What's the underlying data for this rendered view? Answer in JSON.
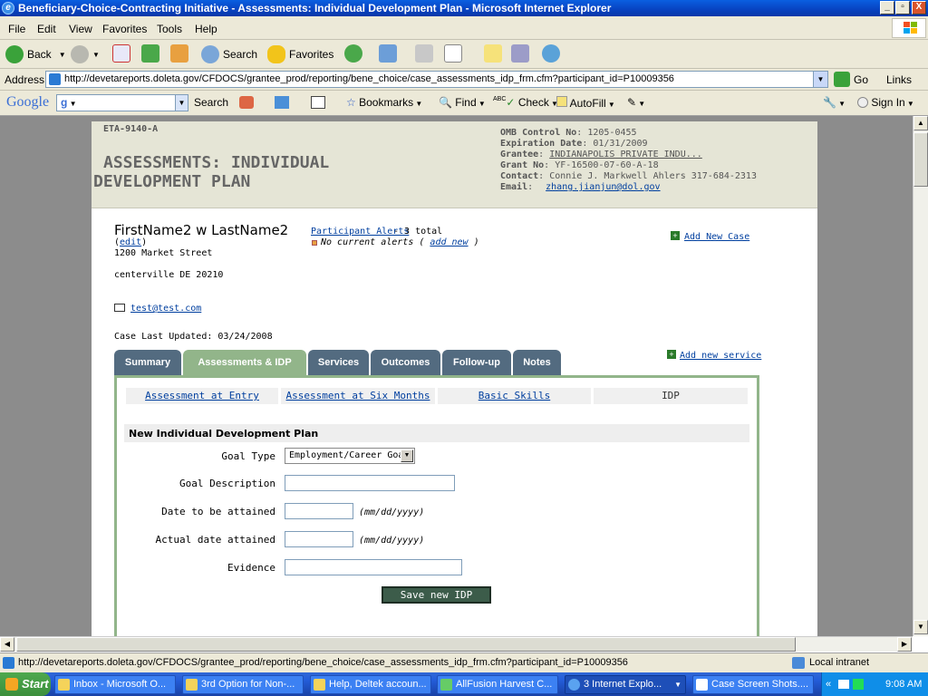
{
  "window": {
    "title": "Beneficiary-Choice-Contracting Initiative - Assessments: Individual Development Plan - Microsoft Internet Explorer",
    "minimize": "_",
    "maximize": "▫",
    "close": "X"
  },
  "menu": [
    "File",
    "Edit",
    "View",
    "Favorites",
    "Tools",
    "Help"
  ],
  "toolbar": {
    "back": "Back",
    "search": "Search",
    "favorites": "Favorites"
  },
  "address": {
    "label": "Address",
    "url": "http://devetareports.doleta.gov/CFDOCS/grantee_prod/reporting/bene_choice/case_assessments_idp_frm.cfm?participant_id=P10009356",
    "go": "Go",
    "links": "Links"
  },
  "google_bar": {
    "logo": "Google",
    "search_value": "g",
    "search": "Search",
    "bookmarks": "Bookmarks",
    "find": "Find",
    "check": "Check",
    "autofill": "AutoFill",
    "signin": "Sign In",
    "abc": "ABC"
  },
  "page": {
    "form_code": "ETA-9140-A",
    "title_line1": "ASSESSMENTS: INDIVIDUAL",
    "title_line2": "DEVELOPMENT PLAN",
    "meta": {
      "omb_label": "OMB Control No",
      "omb": ": 1205-0455",
      "exp_label": "Expiration Date",
      "exp": ": 01/31/2009",
      "grantee_label": "Grantee",
      "grantee_sep": ": ",
      "grantee": "INDIANAPOLIS PRIVATE INDU...",
      "grant_label": "Grant No",
      "grant": ": YF-16500-07-60-A-18",
      "contact_label": "Contact",
      "contact": ": Connie J. Markwell Ahlers  317-684-2313",
      "email_label": "Email",
      "email_sep": ":",
      "email": "zhang.jianjun@dol.gov"
    },
    "participant": {
      "name": "FirstName2 w LastName2",
      "edit_open": "(",
      "edit": "edit",
      "edit_close": ")",
      "street": "1200 Market Street",
      "city": "centerville DE 20210",
      "email": "test@test.com",
      "last_updated": "Case Last Updated: 03/24/2008"
    },
    "alerts": {
      "link": "Participant Alerts",
      "total": " - 3 total",
      "none_prefix": "No current alerts (",
      "add_new": "add new",
      "none_suffix": ")"
    },
    "add_new_case": "Add New Case",
    "add_new_service": "Add new service",
    "tabs": [
      "Summary",
      "Assessments & IDP",
      "Services",
      "Outcomes",
      "Follow-up",
      "Notes"
    ],
    "subtabs": [
      "Assessment at Entry",
      "Assessment at Six Months",
      "Basic Skills",
      "IDP"
    ],
    "form": {
      "heading": "New Individual Development Plan",
      "goal_type_label": "Goal Type",
      "goal_type_value": "Employment/Career Goal",
      "goal_desc_label": "Goal Description",
      "date_attain_label": "Date to be attained",
      "actual_date_label": "Actual date attained",
      "evidence_label": "Evidence",
      "date_hint": "(mm/dd/yyyy)",
      "submit": "Save new IDP"
    }
  },
  "status": {
    "url": "http://devetareports.doleta.gov/CFDOCS/grantee_prod/reporting/bene_choice/case_assessments_idp_frm.cfm?participant_id=P10009356",
    "zone": "Local intranet"
  },
  "taskbar": {
    "start": "Start",
    "tasks": [
      "Inbox - Microsoft O...",
      "3rd Option for Non-...",
      "Help, Deltek accoun...",
      "AllFusion Harvest C...",
      "3 Internet Explo...",
      "Case Screen Shots...."
    ],
    "time": "9:08 AM",
    "collapse": "«"
  },
  "colors": {
    "tab": "#536b80",
    "tab_active": "#92b58a",
    "header_bg": "#e5e5d6",
    "link": "#003f9f"
  }
}
